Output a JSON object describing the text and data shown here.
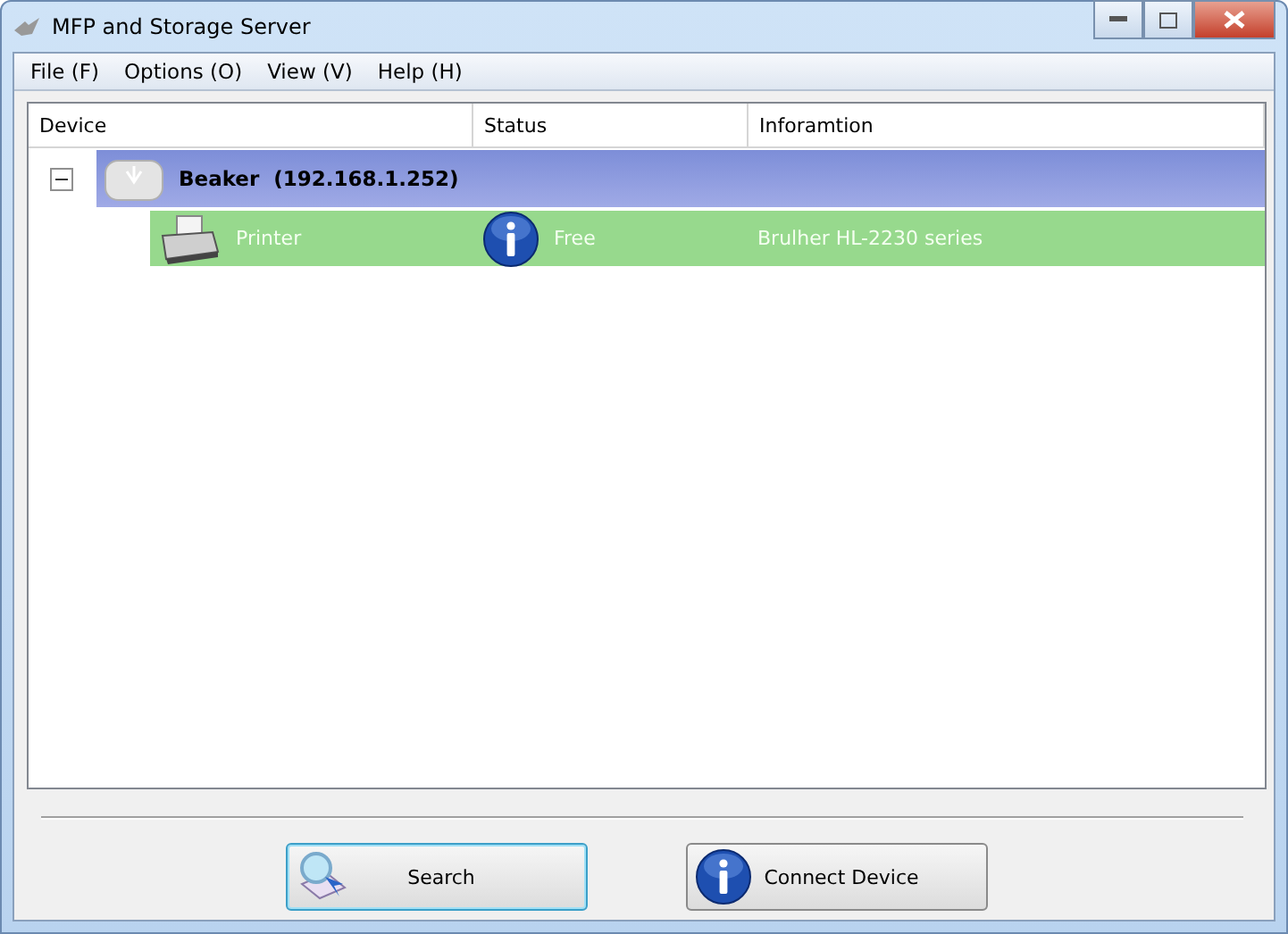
{
  "window": {
    "title": "MFP and Storage Server"
  },
  "menu": [
    {
      "label": "File (F)"
    },
    {
      "label": "Options (O)"
    },
    {
      "label": "View (V)"
    },
    {
      "label": "Help (H)"
    }
  ],
  "table": {
    "columns": [
      "Device",
      "Status",
      "Inforamtion"
    ],
    "groups": [
      {
        "name": "Beaker  (192.168.1.252)",
        "expanded": true,
        "selected": true,
        "children": [
          {
            "name": "Printer",
            "status": "Free",
            "information": "Brulher HL-2230 series",
            "selected": true
          }
        ]
      }
    ]
  },
  "buttons": [
    {
      "label": "Search",
      "kind": "search",
      "focused": true
    },
    {
      "label": "Connect Device",
      "kind": "connect",
      "focused": false
    }
  ]
}
